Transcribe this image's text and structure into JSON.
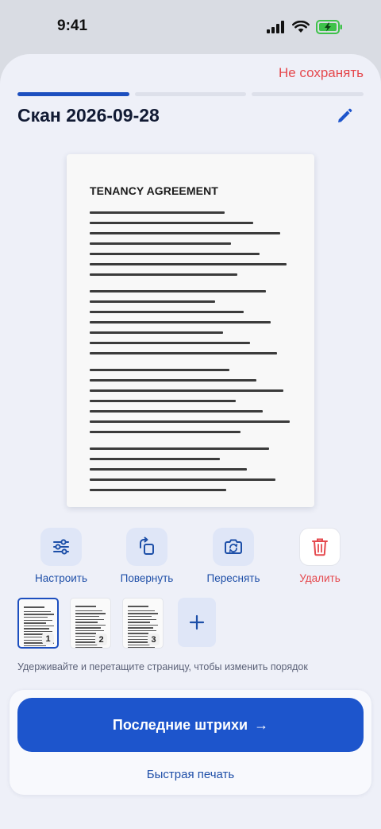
{
  "status_bar": {
    "time": "9:41",
    "icons": [
      "signal-icon",
      "wifi-icon",
      "battery-charging-icon"
    ]
  },
  "header": {
    "discard_label": "Не сохранять",
    "title": "Скан 2026-09-28",
    "progress": {
      "total_steps": 3,
      "current_step": 1
    }
  },
  "document": {
    "heading": "TENANCY AGREEMENT"
  },
  "actions": [
    {
      "label": "Настроить",
      "icon": "sliders-icon"
    },
    {
      "label": "Повернуть",
      "icon": "rotate-icon"
    },
    {
      "label": "Переснять",
      "icon": "retake-camera-icon"
    },
    {
      "label": "Удалить",
      "icon": "trash-icon"
    }
  ],
  "pages": [
    {
      "number": "1",
      "selected": true
    },
    {
      "number": "2",
      "selected": false
    },
    {
      "number": "3",
      "selected": false
    }
  ],
  "add_page_label": "+",
  "hint": "Удерживайте и перетащите страницу, чтобы изменить порядок",
  "footer": {
    "primary_label": "Последние штрихи",
    "primary_arrow": "→",
    "secondary_label": "Быстрая печать"
  },
  "colors": {
    "accent": "#1d55cc",
    "danger": "#e5484d",
    "sheet_bg": "#eef0f8"
  }
}
